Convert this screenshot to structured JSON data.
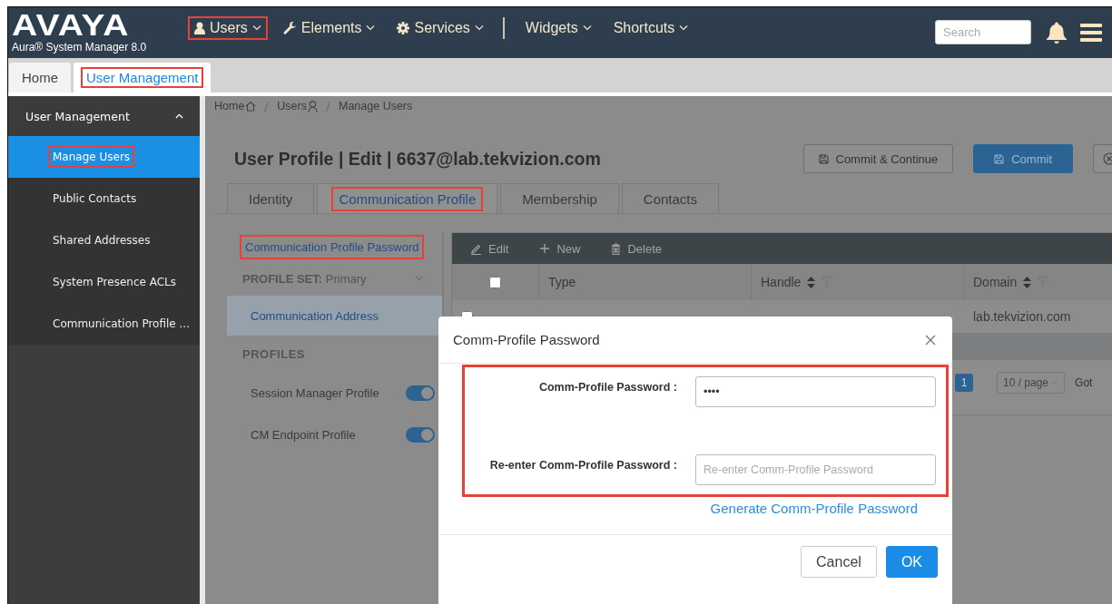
{
  "header": {
    "logo": "AVAYA",
    "product": "Aura® System Manager 8.0",
    "nav": [
      {
        "label": "Users",
        "highlighted": true
      },
      {
        "label": "Elements",
        "highlighted": false
      },
      {
        "label": "Services",
        "highlighted": false
      },
      {
        "label": "Widgets",
        "highlighted": false
      },
      {
        "label": "Shortcuts",
        "highlighted": false
      }
    ],
    "search": {
      "placeholder": "Search"
    }
  },
  "tabs": [
    {
      "label": "Home",
      "selected": false,
      "highlighted": false
    },
    {
      "label": "User Management",
      "selected": true,
      "highlighted": true
    }
  ],
  "sidebar": {
    "title": "User Management",
    "expanded": true,
    "items": [
      {
        "label": "Manage Users",
        "selected": true,
        "highlighted": true
      },
      {
        "label": "Public Contacts",
        "selected": false,
        "highlighted": false
      },
      {
        "label": "Shared Addresses",
        "selected": false,
        "highlighted": false
      },
      {
        "label": "System Presence ACLs",
        "selected": false,
        "highlighted": false
      },
      {
        "label": "Communication Profile ...",
        "selected": false,
        "highlighted": false
      }
    ]
  },
  "breadcrumb": [
    {
      "label": "Home"
    },
    {
      "label": "Users"
    },
    {
      "label": "Manage Users"
    }
  ],
  "page_title": "User Profile | Edit | 6637@lab.tekvizion.com",
  "actions": [
    {
      "kind": "secondary",
      "label": "Commit & Continue"
    },
    {
      "kind": "primary",
      "label": "Commit"
    },
    {
      "kind": "icon"
    }
  ],
  "profile_tabs": [
    {
      "label": "Identity",
      "selected": false,
      "highlighted": false
    },
    {
      "label": "Communication Profile",
      "selected": true,
      "highlighted": true
    },
    {
      "label": "Membership",
      "selected": false,
      "highlighted": false
    },
    {
      "label": "Contacts",
      "selected": false,
      "highlighted": false
    }
  ],
  "profile_nav": [
    {
      "kind": "link",
      "label": "Communication Profile Password",
      "highlighted": true
    },
    {
      "kind": "select",
      "label": "PROFILE SET:",
      "value": "Primary"
    },
    {
      "kind": "item",
      "label": "Communication Address",
      "selected": true
    },
    {
      "kind": "heading",
      "label": "PROFILES"
    },
    {
      "kind": "toggle",
      "label": "Session Manager Profile",
      "on": true
    },
    {
      "kind": "toggle",
      "label": "CM Endpoint Profile",
      "on": true
    }
  ],
  "table": {
    "toolbar": [
      {
        "label": "Edit"
      },
      {
        "label": "New"
      },
      {
        "label": "Delete"
      }
    ],
    "select_all_checked": false,
    "columns": [
      {
        "label": "Type",
        "sortable": false
      },
      {
        "label": "Handle",
        "sortable": true
      },
      {
        "label": "Domain",
        "sortable": true
      }
    ],
    "rows": [
      {
        "checked": false,
        "domain": "lab.tekvizion.com"
      }
    ]
  },
  "pagination": {
    "pages": [
      {
        "label": "1",
        "selected": true
      }
    ],
    "page_size": "10 / page",
    "goto": "Got"
  },
  "dialog": {
    "title": "Comm-Profile Password",
    "fields_highlighted": true,
    "fields": [
      {
        "label": "Comm-Profile Password :",
        "value": "••••"
      },
      {
        "label": "Re-enter Comm-Profile Password :",
        "placeholder": "Re-enter Comm-Profile Password"
      }
    ],
    "link": "Generate Comm-Profile Password",
    "buttons": [
      {
        "kind": "secondary",
        "label": "Cancel"
      },
      {
        "kind": "primary",
        "label": "OK"
      }
    ]
  }
}
